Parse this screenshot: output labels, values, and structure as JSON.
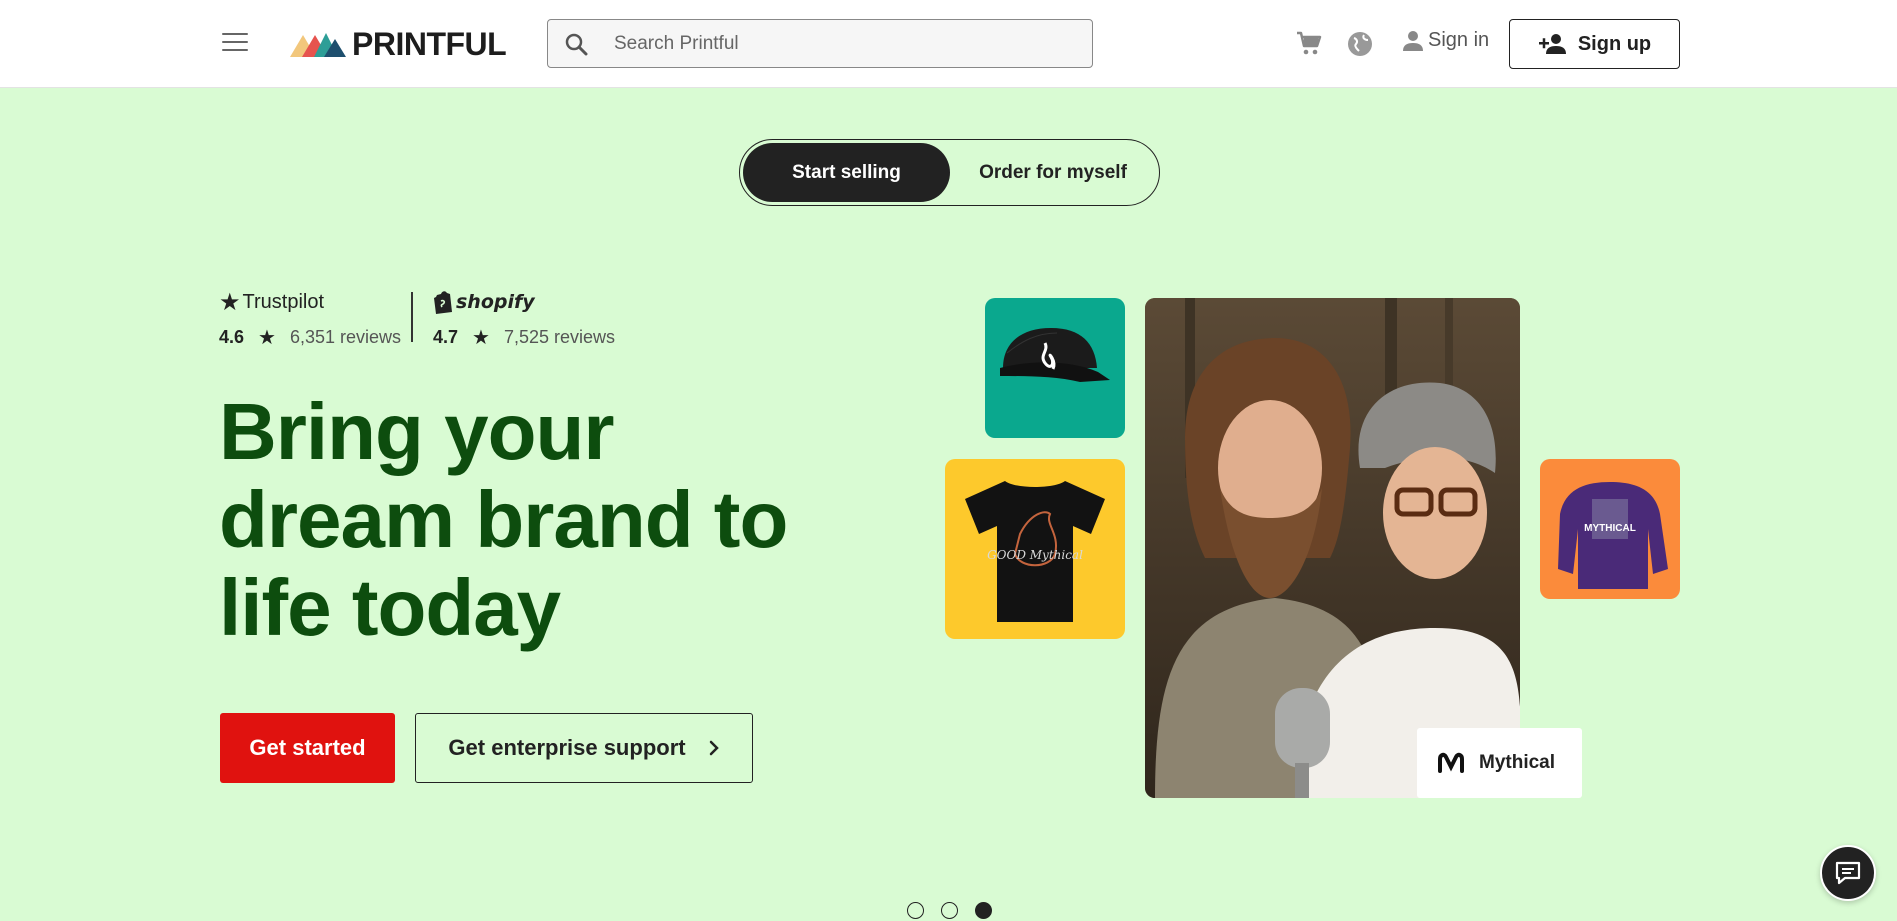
{
  "header": {
    "logo_text": "PRINTFUL",
    "search_placeholder": "Search Printful",
    "signin_label": "Sign in",
    "signup_label": "Sign up"
  },
  "toggle": {
    "active_label": "Start selling",
    "inactive_label": "Order for myself"
  },
  "ratings": [
    {
      "brand": "Trustpilot",
      "score": "4.6",
      "reviews": "6,351 reviews"
    },
    {
      "brand": "shopify",
      "score": "4.7",
      "reviews": "7,525 reviews"
    }
  ],
  "hero": {
    "headline_line1": "Bring your",
    "headline_line2": "dream brand to",
    "headline_line3": "life today",
    "cta_primary": "Get started",
    "cta_secondary": "Get enterprise support"
  },
  "collage": {
    "brand_name": "Mythical",
    "hoodie_print": "MYTHICAL",
    "tee_print": "GOOD Mythical"
  },
  "carousel": {
    "slide_count": 3,
    "active_index": 2
  },
  "colors": {
    "background": "#d9fbd3",
    "headline": "#0d4d0e",
    "primary": "#e0120f",
    "hat_tile": "#0aa88e",
    "tee_tile": "#fdc92c",
    "hoodie_tile": "#fb8b3b"
  },
  "icons": [
    "menu-icon",
    "search-icon",
    "cart-icon",
    "globe-icon",
    "user-icon",
    "add-user-icon",
    "star-icon",
    "shopify-bag-icon",
    "chevron-right-icon",
    "chat-icon"
  ]
}
